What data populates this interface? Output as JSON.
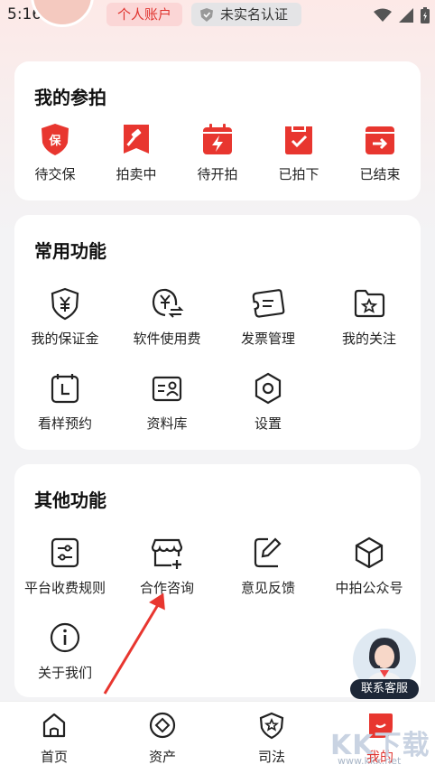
{
  "status_bar": {
    "time": "5:16"
  },
  "header": {
    "account_label": "个人账户",
    "verify_label": "未实名认证"
  },
  "my_auction": {
    "title": "我的参拍",
    "items": [
      {
        "label": "待交保",
        "icon": "deposit-shield-icon"
      },
      {
        "label": "拍卖中",
        "icon": "gavel-icon"
      },
      {
        "label": "待开拍",
        "icon": "calendar-bolt-icon"
      },
      {
        "label": "已拍下",
        "icon": "bag-check-icon"
      },
      {
        "label": "已结束",
        "icon": "box-arrow-icon"
      }
    ]
  },
  "common": {
    "title": "常用功能",
    "items": [
      {
        "label": "我的保证金",
        "icon": "yuan-shield-icon"
      },
      {
        "label": "软件使用费",
        "icon": "yuan-exchange-icon"
      },
      {
        "label": "发票管理",
        "icon": "ticket-icon"
      },
      {
        "label": "我的关注",
        "icon": "folder-star-icon"
      },
      {
        "label": "看样预约",
        "icon": "calendar-clock-icon"
      },
      {
        "label": "资料库",
        "icon": "id-card-icon"
      },
      {
        "label": "设置",
        "icon": "settings-icon"
      }
    ]
  },
  "other": {
    "title": "其他功能",
    "items": [
      {
        "label": "平台收费规则",
        "icon": "sliders-icon"
      },
      {
        "label": "合作咨询",
        "icon": "store-plus-icon"
      },
      {
        "label": "意见反馈",
        "icon": "edit-icon"
      },
      {
        "label": "中拍公众号",
        "icon": "cube-icon"
      },
      {
        "label": "关于我们",
        "icon": "info-icon"
      }
    ]
  },
  "customer_service": {
    "label": "联系客服"
  },
  "tabbar": {
    "items": [
      {
        "label": "首页",
        "icon": "home-icon"
      },
      {
        "label": "资产",
        "icon": "diamond-icon"
      },
      {
        "label": "司法",
        "icon": "justice-shield-icon"
      },
      {
        "label": "我的",
        "icon": "profile-icon"
      }
    ],
    "active": "我的"
  },
  "watermark": {
    "text": "KK下载",
    "url": "www.kkx.net"
  },
  "colors": {
    "accent": "#e0342f",
    "card": "#ffffff",
    "background": "#f3f3f5"
  }
}
